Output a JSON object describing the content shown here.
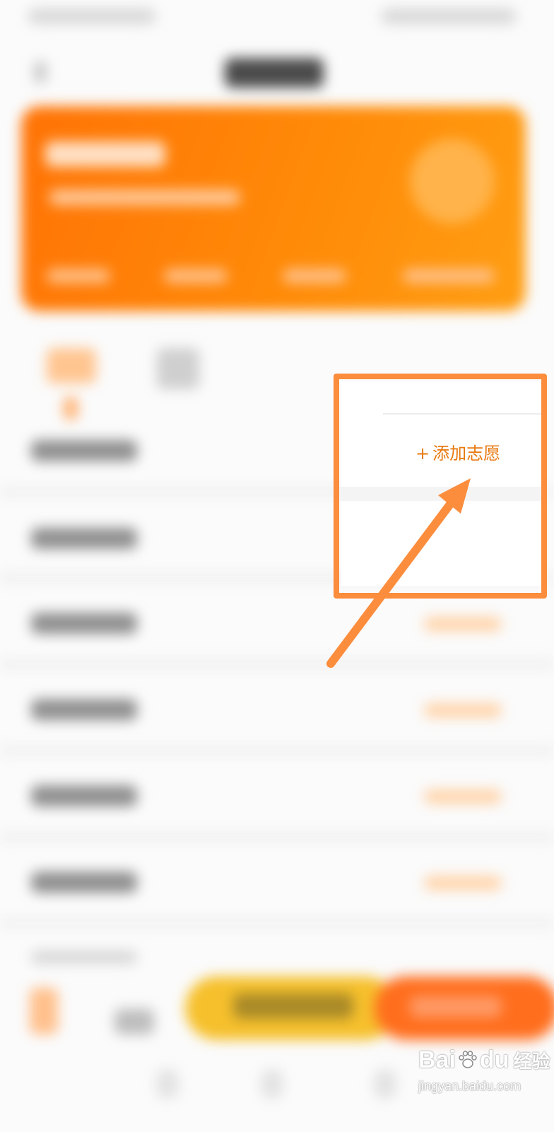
{
  "action": {
    "add_wish_plus": "+",
    "add_wish_label": "添加志愿"
  },
  "watermark": {
    "logo_text": "Bai",
    "logo_suffix": "du",
    "product": "经验",
    "url": "jingyan.baidu.com"
  },
  "colors": {
    "accent_orange": "#ff8a08",
    "highlight_border": "#fb8d3d",
    "action_text": "#e8780f",
    "button_yellow": "#f6c02c",
    "button_orange": "#ff6e1d"
  },
  "icons": {
    "back": "back-arrow-icon",
    "annotation_arrow": "annotation-arrow-icon",
    "watermark_paw": "baidu-paw-icon"
  }
}
